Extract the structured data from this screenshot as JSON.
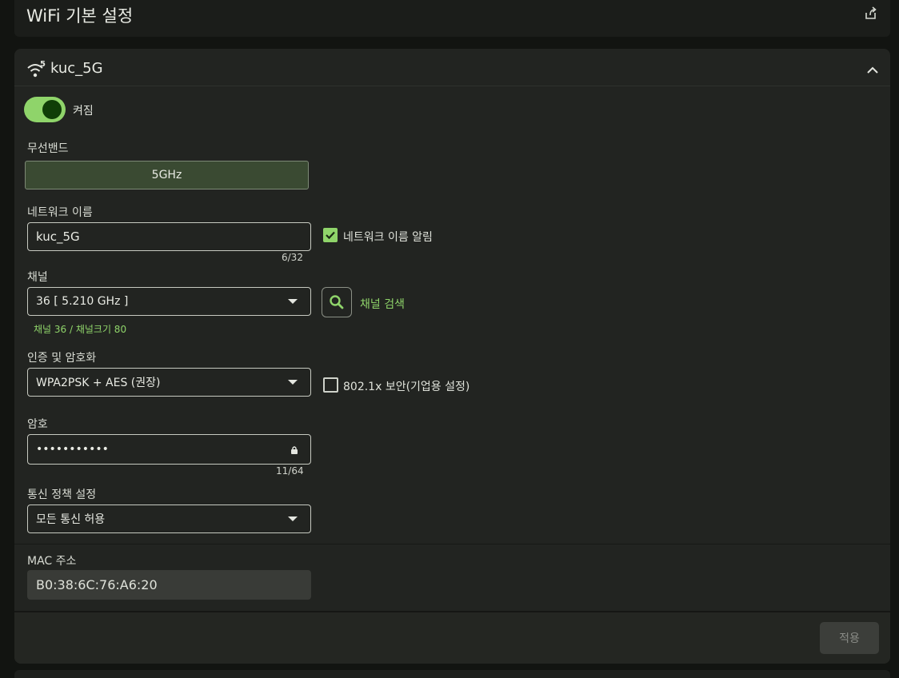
{
  "header": {
    "title": "WiFi 기본 설정",
    "share_icon": "share-icon"
  },
  "network": {
    "ssid_title": "kuc_5G",
    "wifi_icon": "wifi-5ghz-icon",
    "wifi_badge": "5",
    "collapse_icon": "chevron-up-icon",
    "enabled": true,
    "enabled_label": "켜짐"
  },
  "band": {
    "label": "무선밴드",
    "value": "5GHz"
  },
  "network_name": {
    "label": "네트워크 이름",
    "value": "kuc_5G",
    "counter": "6/32",
    "broadcast_label": "네트워크 이름 알림",
    "broadcast_checked": true
  },
  "channel": {
    "label": "채널",
    "value": "36 [ 5.210 GHz ]",
    "search_label": "채널 검색",
    "info": "채널 36 / 채널크기 80"
  },
  "auth": {
    "label": "인증 및 암호화",
    "value": "WPA2PSK + AES (권장)",
    "enterprise_label": "802.1x 보안(기업용 설정)",
    "enterprise_checked": false
  },
  "password": {
    "label": "암호",
    "value": "•••••••••••",
    "counter": "11/64",
    "lock_icon": "lock-icon"
  },
  "policy": {
    "label": "통신 정책 설정",
    "value": "모든 통신 허용"
  },
  "mac": {
    "label": "MAC 주소",
    "value": "B0:38:6C:76:A6:20"
  },
  "footer": {
    "apply_label": "적용"
  },
  "colors": {
    "accent": "#8fd46a",
    "background": "#222421"
  }
}
